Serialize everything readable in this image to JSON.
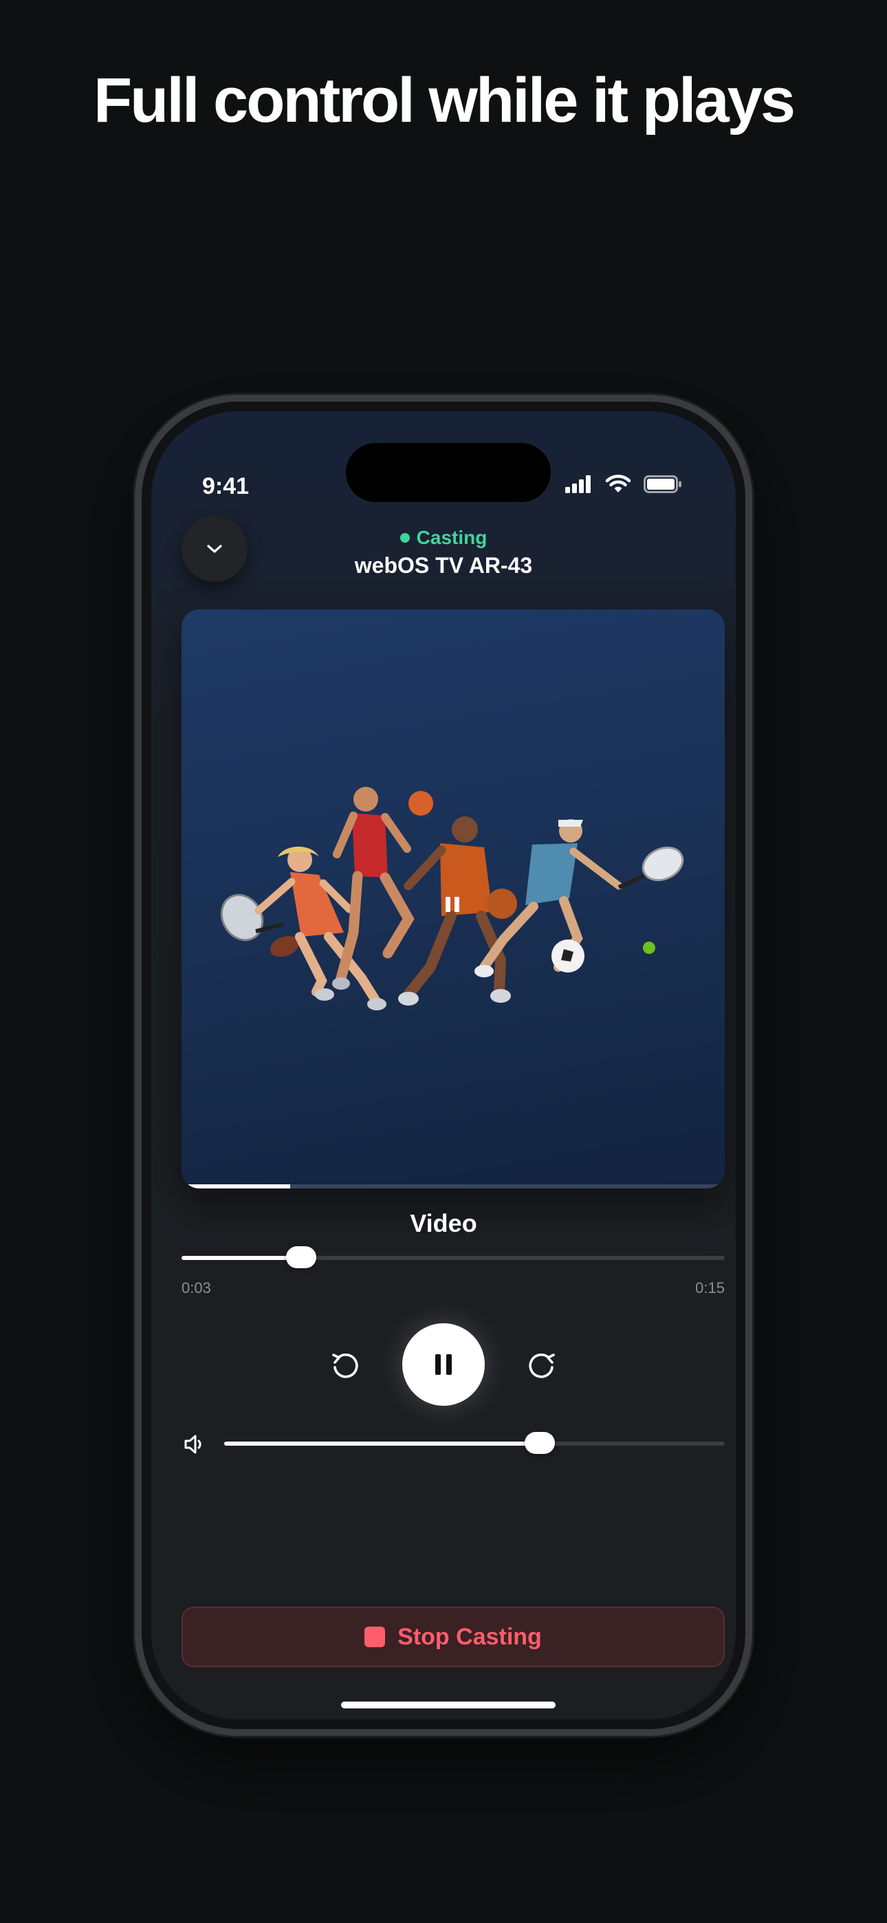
{
  "headline": "Full control while it plays",
  "status_bar": {
    "time": "9:41",
    "icons": [
      "cellular-signal-icon",
      "wifi-icon",
      "battery-icon"
    ]
  },
  "header": {
    "collapse_icon": "chevron-down-icon",
    "cast_status": "Casting",
    "device_name": "webOS TV AR-43"
  },
  "player": {
    "video_progress_fraction": 0.2,
    "title": "Video",
    "elapsed": "0:03",
    "duration": "0:15",
    "seek_fraction": 0.22,
    "volume_fraction": 0.63,
    "controls": {
      "rewind_icon": "rewind-icon",
      "play_pause_icon": "pause-icon",
      "forward_icon": "forward-icon",
      "volume_icon": "speaker-icon"
    }
  },
  "stop_button": {
    "label": "Stop Casting",
    "icon": "stop-icon"
  },
  "colors": {
    "background": "#0f1011",
    "accent_green": "#3fd69a",
    "stop_red": "#ff5d6a",
    "stop_bg": "#3a2124"
  }
}
